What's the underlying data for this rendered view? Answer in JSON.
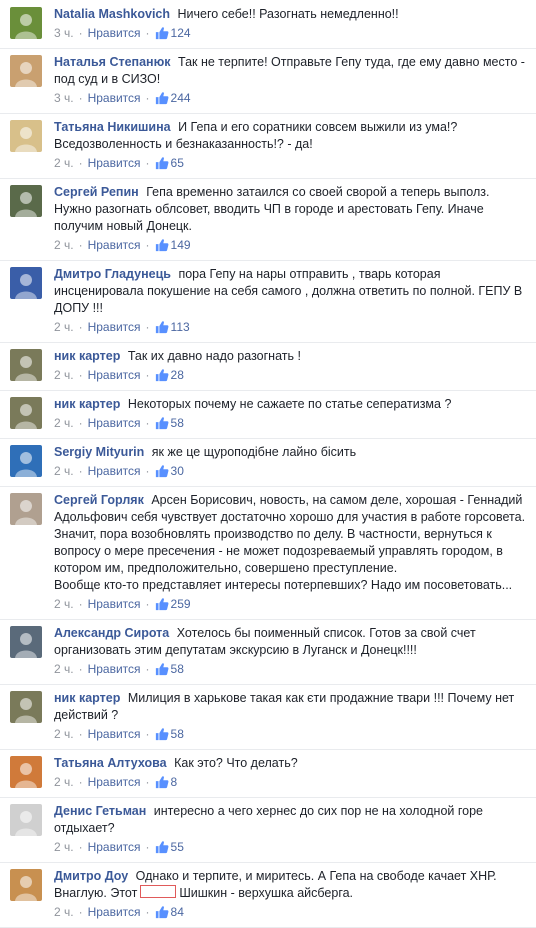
{
  "comments": [
    {
      "author": "Natalia Mashkovich",
      "text": "Ничего себе!! Разогнать немедленно!!",
      "time": "3 ч.",
      "like_label": "Нравится",
      "likes": "124",
      "avatar_color": "#6a8f3a"
    },
    {
      "author": "Наталья Степанюк",
      "text": "Так не терпите! Отправьте Гепу туда, где ему давно место - под суд и в СИЗО!",
      "time": "3 ч.",
      "like_label": "Нравится",
      "likes": "244",
      "avatar_color": "#c9a070"
    },
    {
      "author": "Татьяна Никишина",
      "text": "И Гепа и его соратники совсем выжили из ума!? Вседозволенность и безнаказанность!? - да!",
      "time": "2 ч.",
      "like_label": "Нравится",
      "likes": "65",
      "avatar_color": "#d8c08a"
    },
    {
      "author": "Сергей Репин",
      "text": "Гепа временно затаился со своей сворой а теперь выполз. Нужно разогнать облсовет, вводить ЧП в городе и арестовать Гепу. Иначе получим новый Донецк.",
      "time": "2 ч.",
      "like_label": "Нравится",
      "likes": "149",
      "avatar_color": "#5a6a4a"
    },
    {
      "author": "Дмитро Гладунець",
      "text": "пора Гепу на нары отправить , тварь которая инсценировала покушение на себя самого , должна ответить по полной. ГЕПУ В ДОПУ !!!",
      "time": "2 ч.",
      "like_label": "Нравится",
      "likes": "113",
      "avatar_color": "#3a5ea8"
    },
    {
      "author": "ник картер",
      "text": "Так их давно надо разогнать !",
      "time": "2 ч.",
      "like_label": "Нравится",
      "likes": "28",
      "avatar_color": "#7a7a5a"
    },
    {
      "author": "ник картер",
      "text": "Некоторых почему не сажаете по статье сеператизма ?",
      "time": "2 ч.",
      "like_label": "Нравится",
      "likes": "58",
      "avatar_color": "#7a7a5a"
    },
    {
      "author": "Sergiy Mityurin",
      "text": "як же це щуроподібне лайно бісить",
      "time": "2 ч.",
      "like_label": "Нравится",
      "likes": "30",
      "avatar_color": "#2f6fb8"
    },
    {
      "author": "Сергей Горляк",
      "text": "Арсен Борисович, новость, на самом деле, хорошая - Геннадий Адольфович себя чувствует достаточно хорошо для участия в работе горсовета. Значит, пора возобновлять производство по делу. В частности, вернуться к вопросу о мере пресечения - не может подозреваемый управлять городом, в котором им, предположительно, совершено преступление.\nВообще кто-то представляет интересы потерпевших? Надо им посоветовать...",
      "time": "2 ч.",
      "like_label": "Нравится",
      "likes": "259",
      "avatar_color": "#b0a090"
    },
    {
      "author": "Александр Сирота",
      "text": "Хотелось бы поименный список. Готов за свой счет организовать этим депутатам экскурсию в Луганск и Донецк!!!!",
      "time": "2 ч.",
      "like_label": "Нравится",
      "likes": "58",
      "avatar_color": "#5a6a7a"
    },
    {
      "author": "ник картер",
      "text": "Милиция в харькове такая как єти продажние твари !!! Почему нет действий ?",
      "time": "2 ч.",
      "like_label": "Нравится",
      "likes": "58",
      "avatar_color": "#7a7a5a"
    },
    {
      "author": "Татьяна Алтухова",
      "text": "Как это? Что делать?",
      "time": "2 ч.",
      "like_label": "Нравится",
      "likes": "8",
      "avatar_color": "#d07a3a"
    },
    {
      "author": "Денис Гетьман",
      "text": "интересно а чего хернес до сих пор не на холодной горе отдыхает?",
      "time": "2 ч.",
      "like_label": "Нравится",
      "likes": "55",
      "avatar_color": "#d0d0d0"
    },
    {
      "author": "Дмитро Доу",
      "text_before": "Однако и терпите, и миритесь. А Гепа на свободе качает ХНР. Внаглую. Этот",
      "text_after": "Шишкин - верхушка айсберга.",
      "time": "2 ч.",
      "like_label": "Нравится",
      "likes": "84",
      "avatar_color": "#c89050"
    }
  ],
  "separator": "·",
  "colors": {
    "author": "#3b5998",
    "meta": "#90949c",
    "like": "#4b67a1",
    "redaction": "#e05a5a"
  }
}
